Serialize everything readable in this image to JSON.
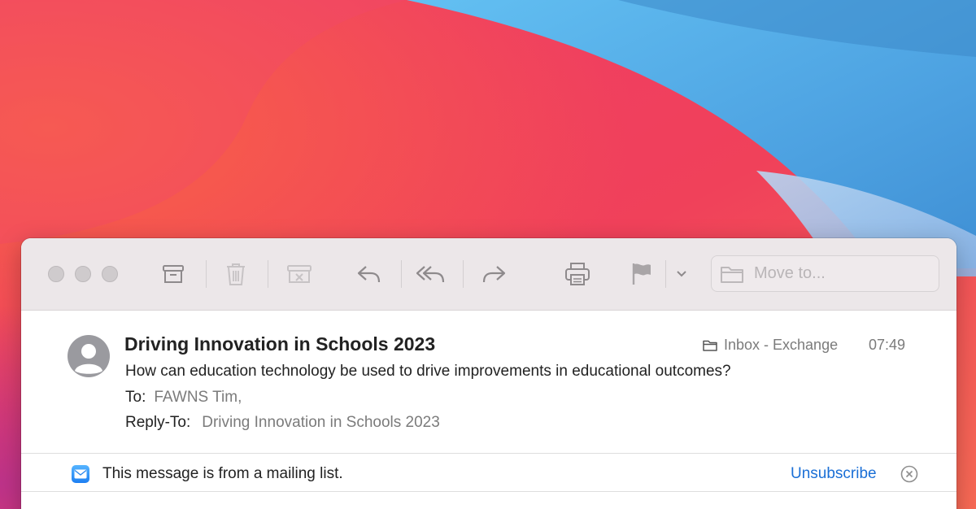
{
  "wallpaper": {
    "colors": {
      "red": "#ee3f5d",
      "orange": "#f8634a",
      "blue": "#56aee8",
      "deep_blue": "#3a86cc",
      "magenta": "#c63a8f"
    }
  },
  "toolbar": {
    "buttons": [
      {
        "name": "archive",
        "icon": "archive-icon"
      },
      {
        "name": "delete",
        "icon": "trash-icon"
      },
      {
        "name": "junk",
        "icon": "junk-icon"
      },
      {
        "name": "reply",
        "icon": "reply-icon"
      },
      {
        "name": "reply-all",
        "icon": "reply-all-icon"
      },
      {
        "name": "forward",
        "icon": "forward-icon"
      },
      {
        "name": "print",
        "icon": "printer-icon"
      },
      {
        "name": "flag",
        "icon": "flag-icon"
      },
      {
        "name": "flag-menu",
        "icon": "chevron-down-icon"
      }
    ],
    "move_to_placeholder": "Move to..."
  },
  "message": {
    "subject": "Driving Innovation in Schools 2023",
    "summary": "How can education technology be used to drive improvements in educational outcomes?",
    "to_label": "To:",
    "to_value": "FAWNS Tim,",
    "reply_to_label": "Reply-To:",
    "reply_to_value": "Driving Innovation in Schools 2023",
    "mailbox": "Inbox - Exchange",
    "time": "07:49"
  },
  "banner": {
    "text": "This message is from a mailing list.",
    "action": "Unsubscribe",
    "accent": "#1a6fd6"
  }
}
